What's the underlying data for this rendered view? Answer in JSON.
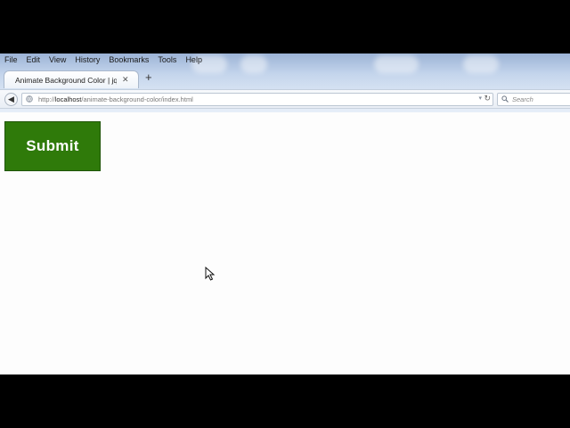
{
  "browser": {
    "menu": [
      "File",
      "Edit",
      "View",
      "History",
      "Bookmarks",
      "Tools",
      "Help"
    ],
    "tab": {
      "title": "Animate Background Color | jq...",
      "close": "✕"
    },
    "new_tab": "+",
    "back": "◀",
    "address": {
      "scheme": "http://",
      "host": "localhost",
      "path": "/animate-background-color/index.html"
    },
    "reload": "↻",
    "dropmarker": "▾",
    "search_placeholder": "Search"
  },
  "page": {
    "submit_label": "Submit",
    "submit_color": "#2f7a0a"
  },
  "icons": {
    "back": "back-arrow-icon",
    "globe": "site-identity-icon",
    "search": "search-icon",
    "cursor": "mouse-pointer-icon"
  }
}
